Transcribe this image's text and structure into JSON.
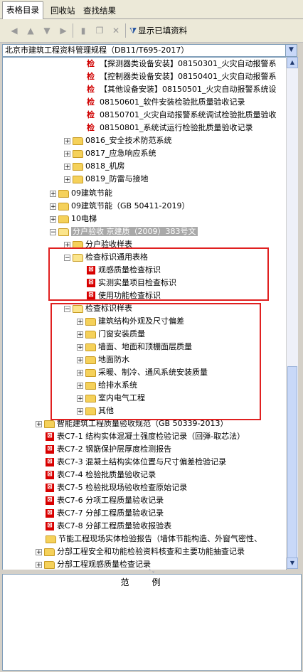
{
  "tabs": [
    {
      "label": "表格目录"
    },
    {
      "label": "回收站"
    },
    {
      "label": "查找结果"
    }
  ],
  "toolbar": {
    "show_filled_label": "显示已填资料"
  },
  "spec_selector": {
    "value": "北京市建筑工程资料管理规程（DB11/T695-2017）"
  },
  "tree": {
    "jian_icon_text": "检",
    "table_icon_text": "⊠",
    "rows": [
      {
        "label": "【探测器类设备安装】08150301_火灾自动报警系"
      },
      {
        "label": "【控制器类设备安装】08150401_火灾自动报警系"
      },
      {
        "label": "【其他设备安装】08150501_火灾自动报警系统设"
      },
      {
        "label": "08150601_软件安装检验批质量验收记录"
      },
      {
        "label": "08150701_火灾自动报警系统调试检验批质量验收"
      },
      {
        "label": "08150801_系统试运行检验批质量验收记录"
      },
      {
        "label": "0816_安全技术防范系统"
      },
      {
        "label": "0817_应急响应系统"
      },
      {
        "label": "0818_机房"
      },
      {
        "label": "0819_防雷与接地"
      },
      {
        "label": "09建筑节能"
      },
      {
        "label": "09建筑节能（GB 50411-2019）"
      },
      {
        "label": "10电梯"
      },
      {
        "label": "分户验收  京建质（2009）383号文"
      },
      {
        "label": "分户验收样表"
      },
      {
        "label": "检查标识通用表格"
      },
      {
        "label": "观感质量检查标识"
      },
      {
        "label": "实测实量项目检查标识"
      },
      {
        "label": "使用功能检查标识"
      },
      {
        "label": "检查标识样表"
      },
      {
        "label": "建筑结构外观及尺寸偏差"
      },
      {
        "label": "门窗安装质量"
      },
      {
        "label": "墙面、地面和顶棚面层质量"
      },
      {
        "label": "地面防水"
      },
      {
        "label": "采暖、制冷、通风系统安装质量"
      },
      {
        "label": "给排水系统"
      },
      {
        "label": "室内电气工程"
      },
      {
        "label": "其他"
      },
      {
        "label": "智能建筑工程质量验收规范（GB 50339-2013）"
      },
      {
        "label": "表C7-1  结构实体混凝土强度检验记录（回弹-取芯法）"
      },
      {
        "label": "表C7-2  钢筋保护层厚度检测报告"
      },
      {
        "label": "表C7-3  混凝土结构实体位置与尺寸偏差检验记录"
      },
      {
        "label": "表C7-4  检验批质量验收记录"
      },
      {
        "label": "表C7-5  检验批现场验收检查原始记录"
      },
      {
        "label": "表C7-6  分项工程质量验收记录"
      },
      {
        "label": "表C7-7  分部工程质量验收记录"
      },
      {
        "label": "表C7-8  分部工程质量验收报验表"
      },
      {
        "label": "节能工程现场实体检验报告（墙体节能构造、外窗气密性、"
      },
      {
        "label": "分部工程安全和功能检验资料核查和主要功能抽查记录"
      },
      {
        "label": "分部工程观感质量检查记录"
      }
    ]
  },
  "legend": {
    "title": "范例"
  }
}
